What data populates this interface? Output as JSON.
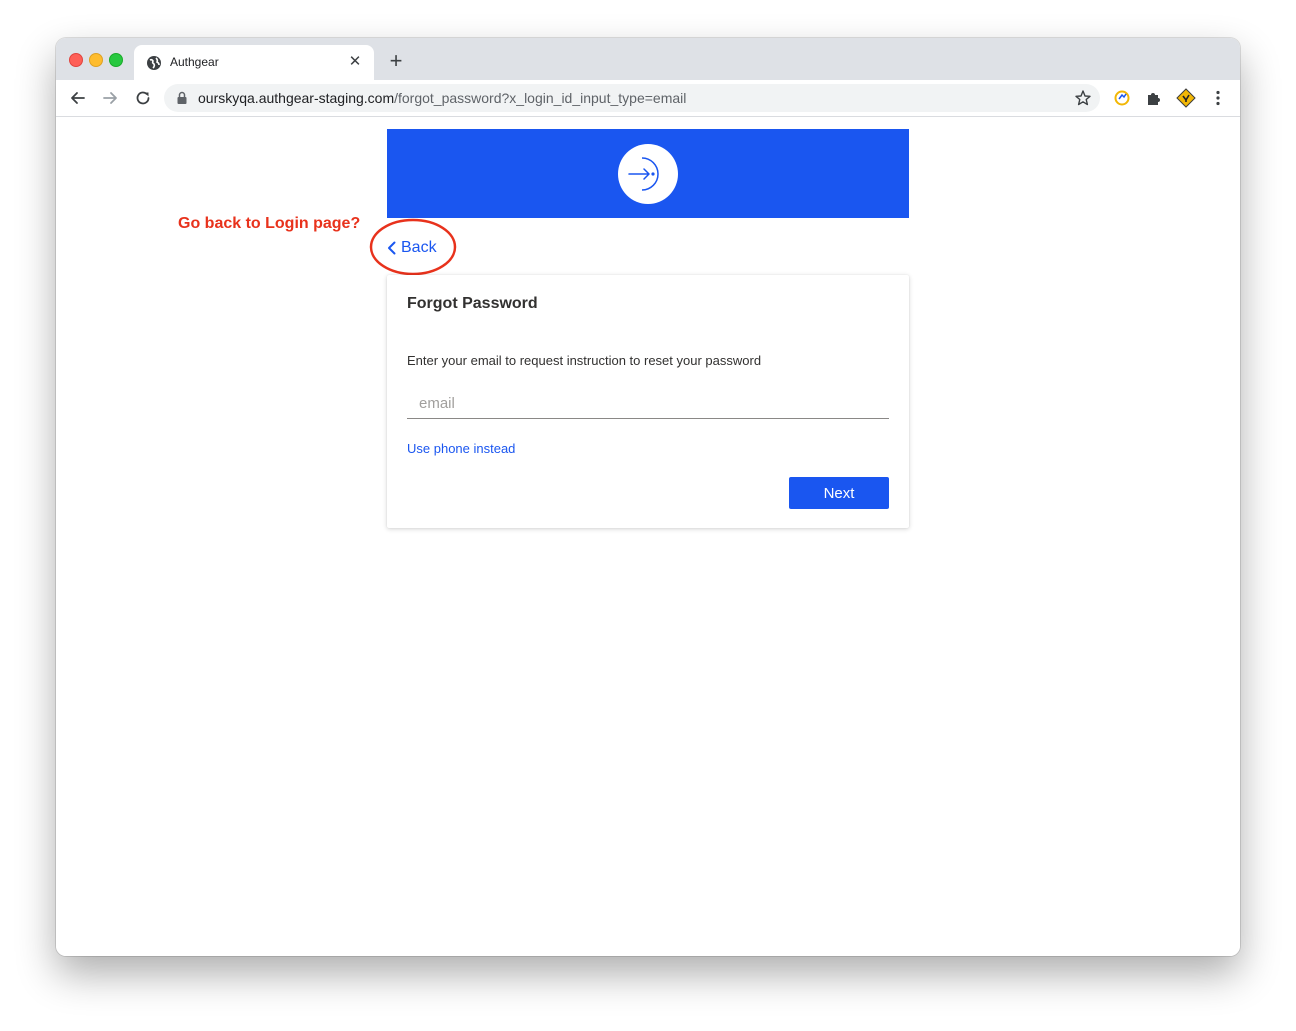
{
  "browser": {
    "tab_title": "Authgear",
    "tab_close_glyph": "✕",
    "new_tab_glyph": "+",
    "url_host": "ourskyqa.authgear-staging.com",
    "url_path": "/forgot_password?x_login_id_input_type=email",
    "icons": {
      "favicon": "globe-icon",
      "back": "arrow-left-icon",
      "forward": "arrow-right-icon",
      "reload": "reload-icon",
      "lock": "lock-icon",
      "bookmark": "star-icon",
      "extensions": [
        "extension-badge-icon",
        "puzzle-icon",
        "diamond-extension-icon"
      ],
      "menu": "kebab-menu-icon"
    }
  },
  "annotation": {
    "text": "Go back to Login page?",
    "color": "#e8321c"
  },
  "page": {
    "brand_color": "#1a56f0",
    "logo_icon": "sign-in-arrow-icon",
    "back_label": "Back",
    "card": {
      "title": "Forgot Password",
      "description": "Enter your email to request instruction to reset your password",
      "email_placeholder": "email",
      "email_value": "",
      "alt_link": "Use phone instead",
      "next_label": "Next"
    }
  }
}
